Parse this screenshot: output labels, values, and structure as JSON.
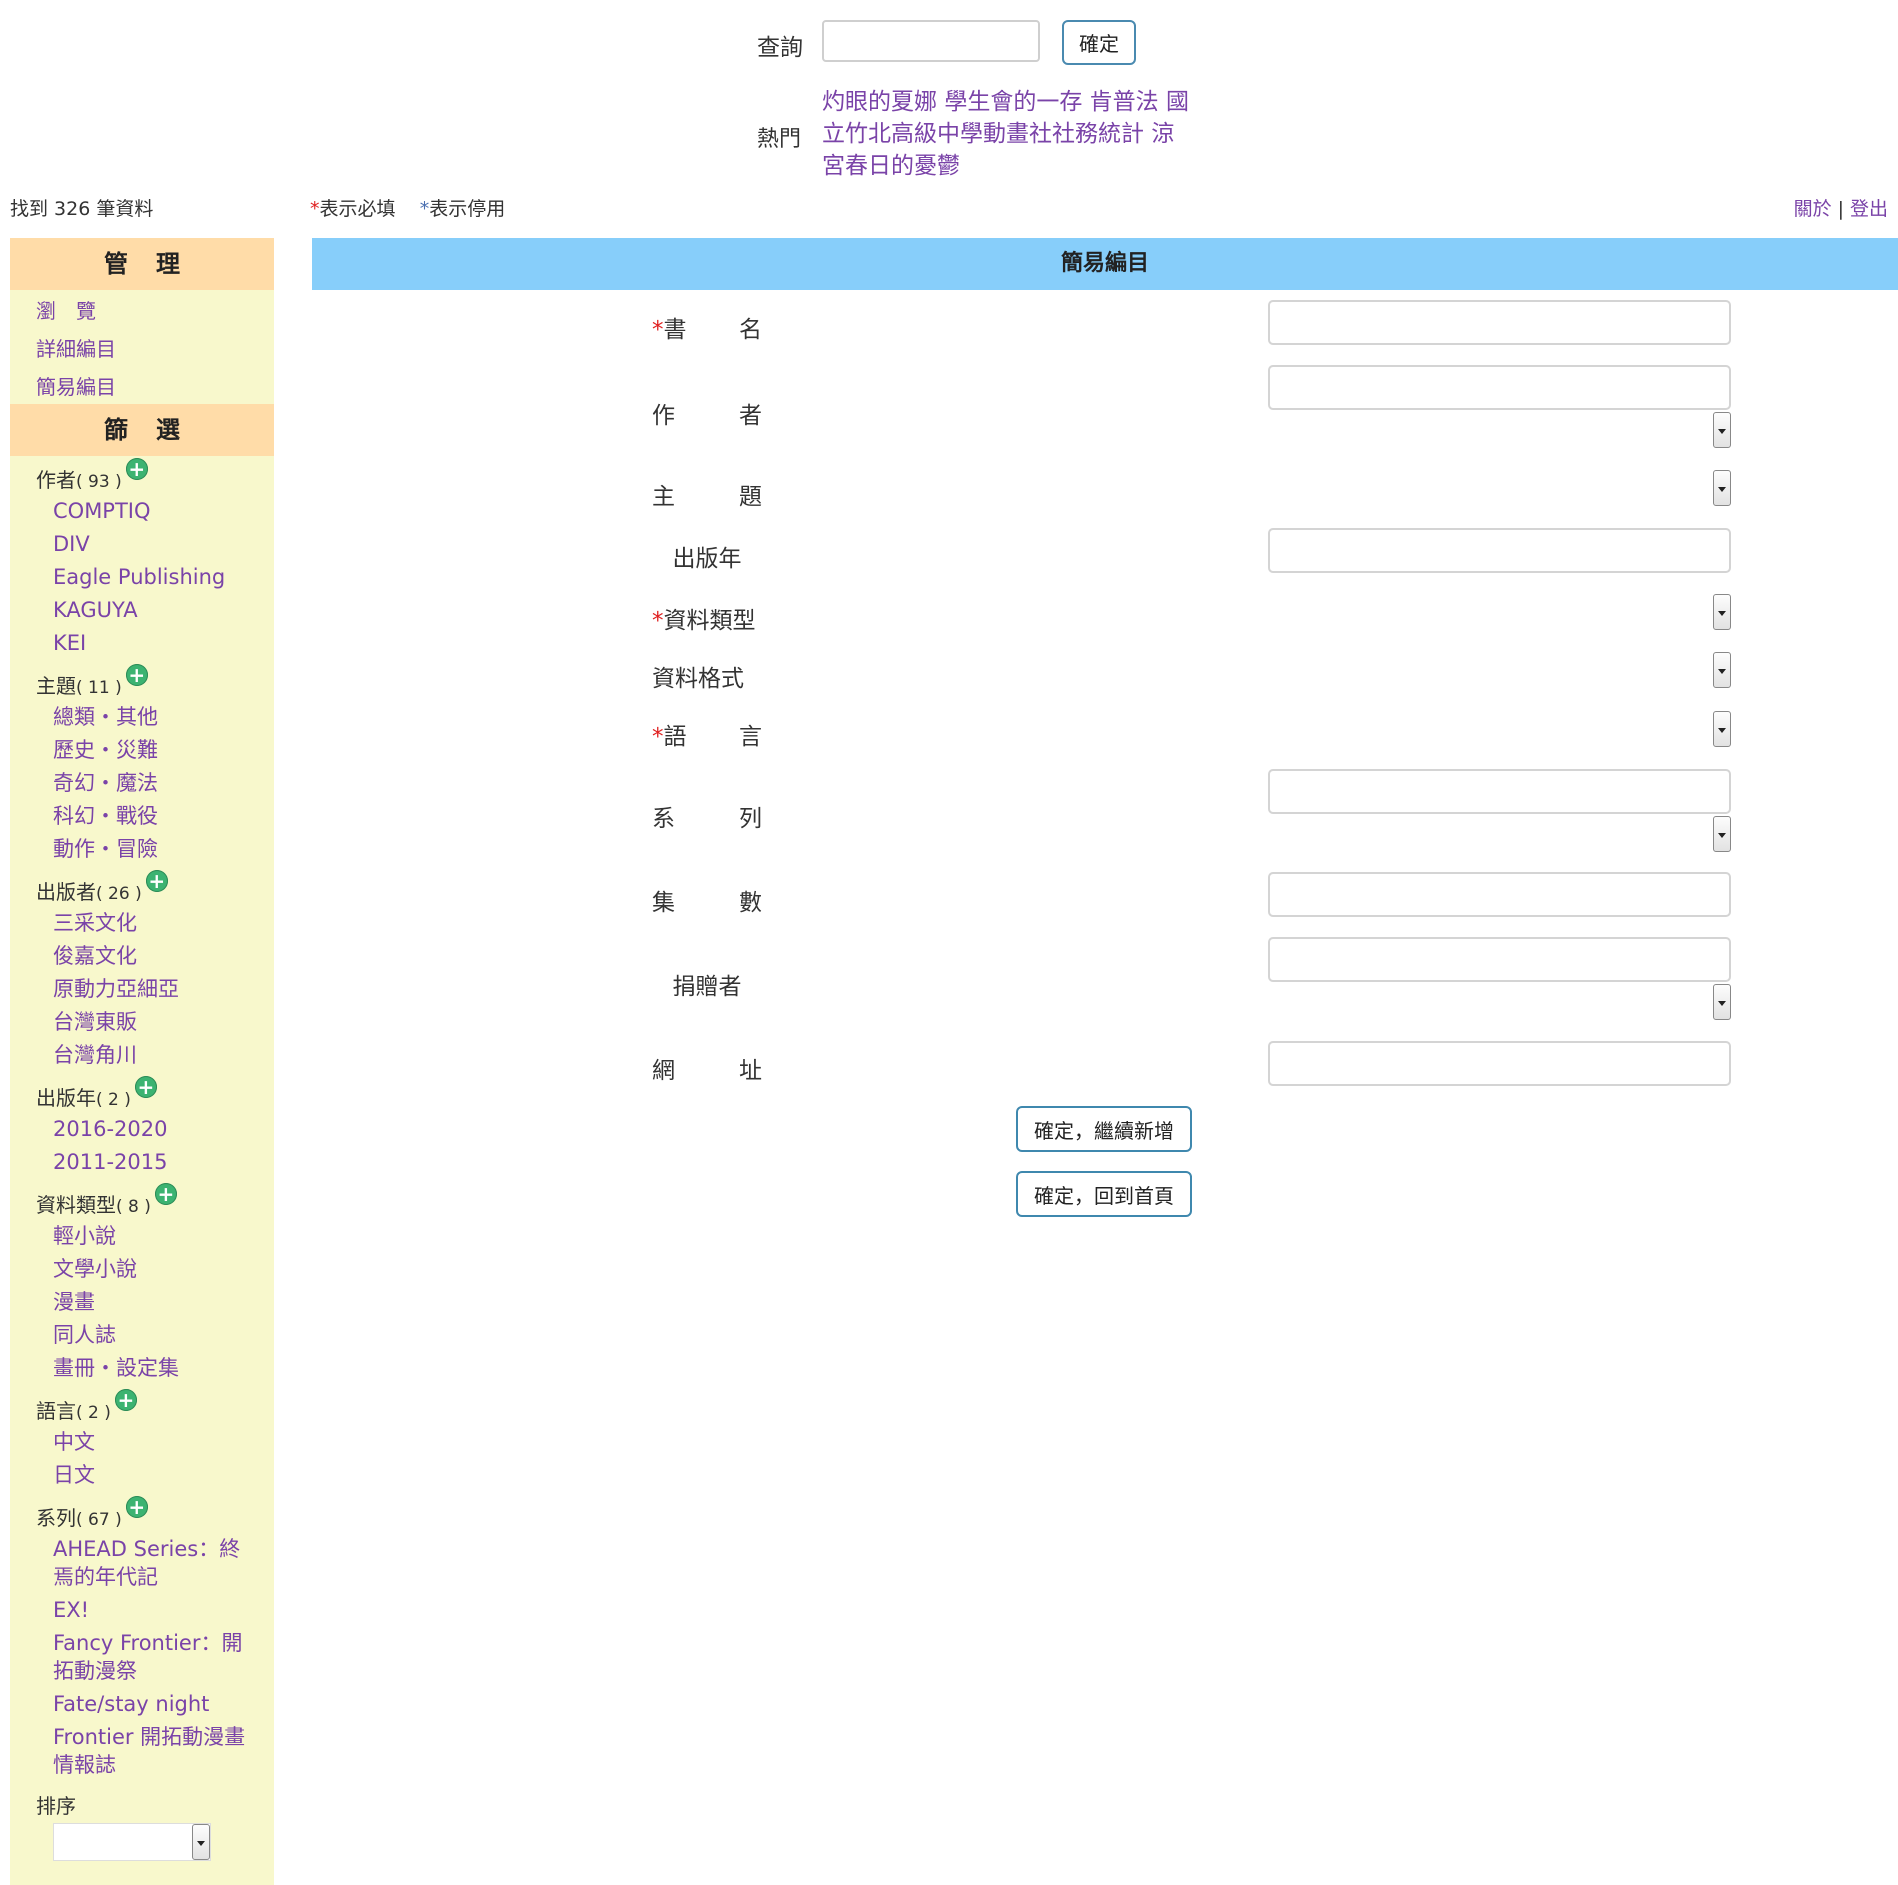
{
  "search": {
    "label": "查詢",
    "value": "",
    "submit_label": "確定"
  },
  "hot": {
    "label": "熱門",
    "links": [
      "灼眼的夏娜",
      "學生會的一存",
      "肯普法",
      "國立竹北高級中學動畫社社務統計",
      "涼宮春日的憂鬱"
    ]
  },
  "topbar": {
    "result_count": "找到 326 筆資料",
    "required_mark": "*",
    "required_text": "表示必填",
    "disabled_mark": "*",
    "disabled_text": "表示停用",
    "about": "關於",
    "separator": "|",
    "logout": "登出"
  },
  "sidebar": {
    "manage_title": "管理",
    "manage_items": [
      "瀏　覽",
      "詳細編目",
      "簡易編目"
    ],
    "filter_title": "篩選",
    "groups": [
      {
        "title": "作者",
        "count": "( 93 )",
        "options": [
          "COMPTIQ",
          "DIV",
          "Eagle Publishing",
          "KAGUYA",
          "KEI"
        ]
      },
      {
        "title": "主題",
        "count": "( 11 )",
        "options": [
          "總類・其他",
          "歷史・災難",
          "奇幻・魔法",
          "科幻・戰役",
          "動作・冒險"
        ]
      },
      {
        "title": "出版者",
        "count": "( 26 )",
        "options": [
          "三采文化",
          "俊嘉文化",
          "原動力亞細亞",
          "台灣東販",
          "台灣角川"
        ]
      },
      {
        "title": "出版年",
        "count": "( 2 )",
        "options": [
          "2016-2020",
          "2011-2015"
        ]
      },
      {
        "title": "資料類型",
        "count": "( 8 )",
        "options": [
          "輕小說",
          "文學小說",
          "漫畫",
          "同人誌",
          "畫冊・設定集"
        ]
      },
      {
        "title": "語言",
        "count": "( 2 )",
        "options": [
          "中文",
          "日文"
        ]
      },
      {
        "title": "系列",
        "count": "( 67 )",
        "options": [
          "AHEAD Series：終焉的年代記",
          "EX!",
          "Fancy Frontier：開拓動漫祭",
          "Fate/stay night",
          "Frontier 開拓動漫畫情報誌"
        ]
      }
    ],
    "sort_label": "排序",
    "sort_value": "",
    "expand_icon": "plus-circle-icon"
  },
  "form": {
    "title": "簡易編目",
    "fields": [
      {
        "mark": "*",
        "label_a": "書",
        "label_b": "名"
      },
      {
        "mark": "",
        "label_a": "作",
        "label_b": "者"
      },
      {
        "mark": "",
        "label_a": "主",
        "label_b": "題"
      },
      {
        "mark": "",
        "label": "出版年"
      },
      {
        "mark": "*",
        "label": "資料類型"
      },
      {
        "mark": "",
        "label": "資料格式"
      },
      {
        "mark": "*",
        "label_a": "語",
        "label_b": "言"
      },
      {
        "mark": "",
        "label_a": "系",
        "label_b": "列"
      },
      {
        "mark": "",
        "label_a": "集",
        "label_b": "數"
      },
      {
        "mark": "",
        "label": "捐贈者"
      },
      {
        "mark": "",
        "label_a": "網",
        "label_b": "址"
      }
    ],
    "submit_continue": "確定，繼續新增",
    "submit_home": "確定，回到首頁"
  },
  "colors": {
    "link": "#7a43a8",
    "sidebar_bg": "#f8f8cc",
    "sidebar_head": "#ffdca8",
    "form_header": "#87cefa",
    "required": "#e02020",
    "expand": "#3cb371"
  }
}
